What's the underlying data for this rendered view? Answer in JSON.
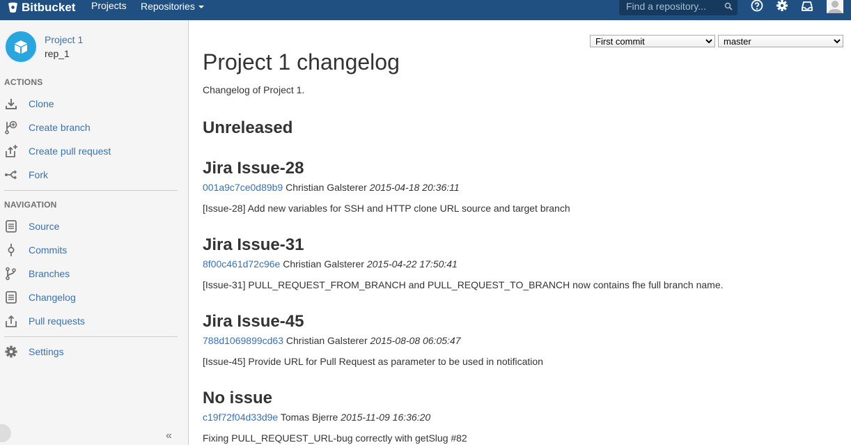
{
  "header": {
    "brand": "Bitbucket",
    "projects_label": "Projects",
    "repositories_label": "Repositories",
    "search_placeholder": "Find a repository...",
    "icons": [
      "bitbucket-logo-icon",
      "search-icon",
      "help-icon",
      "gear-icon",
      "inbox-icon",
      "user-avatar-icon"
    ],
    "brand_color": "#205081"
  },
  "sidebar": {
    "project_name": "Project 1",
    "repo_name": "rep_1",
    "actions_title": "ACTIONS",
    "actions": [
      {
        "label": "Clone",
        "icon": "clone-icon"
      },
      {
        "label": "Create branch",
        "icon": "create-branch-icon"
      },
      {
        "label": "Create pull request",
        "icon": "create-pull-request-icon"
      },
      {
        "label": "Fork",
        "icon": "fork-icon"
      }
    ],
    "navigation_title": "NAVIGATION",
    "navigation": [
      {
        "label": "Source",
        "icon": "source-icon"
      },
      {
        "label": "Commits",
        "icon": "commits-icon"
      },
      {
        "label": "Branches",
        "icon": "branches-icon"
      },
      {
        "label": "Changelog",
        "icon": "changelog-icon"
      },
      {
        "label": "Pull requests",
        "icon": "pull-requests-icon"
      }
    ],
    "settings_label": "Settings",
    "collapse_label": "«"
  },
  "main": {
    "from_select": "First commit",
    "to_select": "master",
    "title": "Project 1 changelog",
    "description": "Changelog of Project 1.",
    "release": "Unreleased",
    "issues": [
      {
        "title": "Jira Issue-28",
        "hash": "001a9c7ce0d89b9",
        "author": "Christian Galsterer",
        "date": "2015-04-18 20:36:11",
        "message": "[Issue-28] Add new variables for SSH and HTTP clone URL source and target branch"
      },
      {
        "title": "Jira Issue-31",
        "hash": "8f00c461d72c96e",
        "author": "Christian Galsterer",
        "date": "2015-04-22 17:50:41",
        "message": "[Issue-31] PULL_REQUEST_FROM_BRANCH and PULL_REQUEST_TO_BRANCH now contains fhe full branch name."
      },
      {
        "title": "Jira Issue-45",
        "hash": "788d1069899cd63",
        "author": "Christian Galsterer",
        "date": "2015-08-08 06:05:47",
        "message": "[Issue-45] Provide URL for Pull Request as parameter to be used in notification"
      },
      {
        "title": "No issue",
        "hash": "c19f72f04d33d9e",
        "author": "Tomas Bjerre",
        "date": "2015-11-09 16:36:20",
        "message": "Fixing PULL_REQUEST_URL-bug correctly with getSlug #82"
      }
    ]
  }
}
